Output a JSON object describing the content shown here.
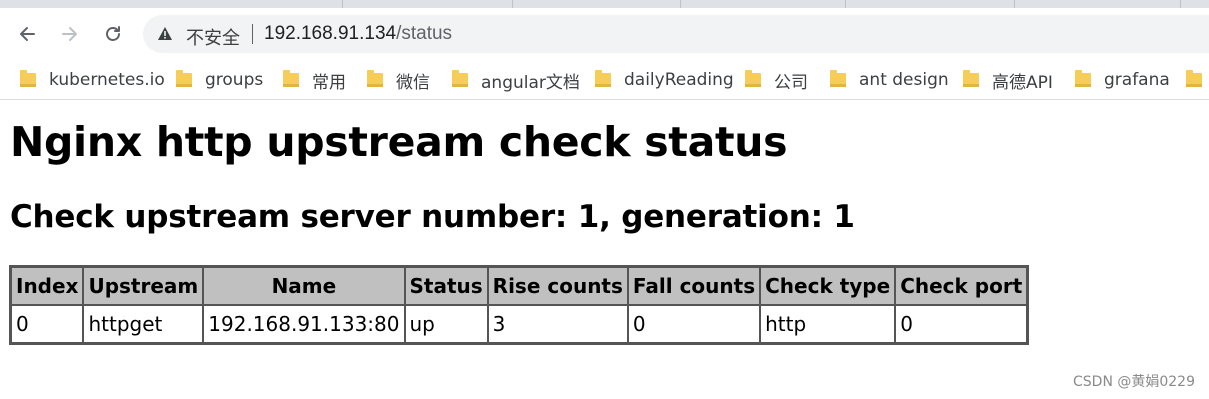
{
  "browser": {
    "security_label": "不安全",
    "url_host": "192.168.91.134",
    "url_path": "/status"
  },
  "bookmarks": [
    {
      "label": "kubernetes.io"
    },
    {
      "label": "groups"
    },
    {
      "label": "常用"
    },
    {
      "label": "微信"
    },
    {
      "label": "angular文档"
    },
    {
      "label": "dailyReading"
    },
    {
      "label": "公司"
    },
    {
      "label": "ant design"
    },
    {
      "label": "高德API"
    },
    {
      "label": "grafana"
    },
    {
      "label": ""
    }
  ],
  "page": {
    "title": "Nginx http upstream check status",
    "subtitle": "Check upstream server number: 1, generation: 1"
  },
  "table": {
    "headers": [
      "Index",
      "Upstream",
      "Name",
      "Status",
      "Rise counts",
      "Fall counts",
      "Check type",
      "Check port"
    ],
    "rows": [
      [
        "0",
        "httpget",
        "192.168.91.133:80",
        "up",
        "3",
        "0",
        "http",
        "0"
      ]
    ]
  },
  "watermark": "CSDN @黄娟0229",
  "colors": {
    "header_bg": "#c0c0c0",
    "table_border": "#555555",
    "omnibox_bg": "#f1f3f4",
    "folder": "#f7cd5a"
  }
}
